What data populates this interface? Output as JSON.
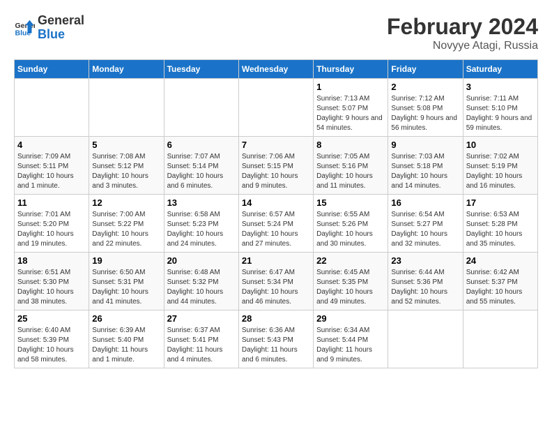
{
  "header": {
    "logo_general": "General",
    "logo_blue": "Blue",
    "month_title": "February 2024",
    "subtitle": "Novyye Atagi, Russia"
  },
  "weekdays": [
    "Sunday",
    "Monday",
    "Tuesday",
    "Wednesday",
    "Thursday",
    "Friday",
    "Saturday"
  ],
  "weeks": [
    [
      {
        "day": "",
        "sunrise": "",
        "sunset": "",
        "daylight": ""
      },
      {
        "day": "",
        "sunrise": "",
        "sunset": "",
        "daylight": ""
      },
      {
        "day": "",
        "sunrise": "",
        "sunset": "",
        "daylight": ""
      },
      {
        "day": "",
        "sunrise": "",
        "sunset": "",
        "daylight": ""
      },
      {
        "day": "1",
        "sunrise": "Sunrise: 7:13 AM",
        "sunset": "Sunset: 5:07 PM",
        "daylight": "Daylight: 9 hours and 54 minutes."
      },
      {
        "day": "2",
        "sunrise": "Sunrise: 7:12 AM",
        "sunset": "Sunset: 5:08 PM",
        "daylight": "Daylight: 9 hours and 56 minutes."
      },
      {
        "day": "3",
        "sunrise": "Sunrise: 7:11 AM",
        "sunset": "Sunset: 5:10 PM",
        "daylight": "Daylight: 9 hours and 59 minutes."
      }
    ],
    [
      {
        "day": "4",
        "sunrise": "Sunrise: 7:09 AM",
        "sunset": "Sunset: 5:11 PM",
        "daylight": "Daylight: 10 hours and 1 minute."
      },
      {
        "day": "5",
        "sunrise": "Sunrise: 7:08 AM",
        "sunset": "Sunset: 5:12 PM",
        "daylight": "Daylight: 10 hours and 3 minutes."
      },
      {
        "day": "6",
        "sunrise": "Sunrise: 7:07 AM",
        "sunset": "Sunset: 5:14 PM",
        "daylight": "Daylight: 10 hours and 6 minutes."
      },
      {
        "day": "7",
        "sunrise": "Sunrise: 7:06 AM",
        "sunset": "Sunset: 5:15 PM",
        "daylight": "Daylight: 10 hours and 9 minutes."
      },
      {
        "day": "8",
        "sunrise": "Sunrise: 7:05 AM",
        "sunset": "Sunset: 5:16 PM",
        "daylight": "Daylight: 10 hours and 11 minutes."
      },
      {
        "day": "9",
        "sunrise": "Sunrise: 7:03 AM",
        "sunset": "Sunset: 5:18 PM",
        "daylight": "Daylight: 10 hours and 14 minutes."
      },
      {
        "day": "10",
        "sunrise": "Sunrise: 7:02 AM",
        "sunset": "Sunset: 5:19 PM",
        "daylight": "Daylight: 10 hours and 16 minutes."
      }
    ],
    [
      {
        "day": "11",
        "sunrise": "Sunrise: 7:01 AM",
        "sunset": "Sunset: 5:20 PM",
        "daylight": "Daylight: 10 hours and 19 minutes."
      },
      {
        "day": "12",
        "sunrise": "Sunrise: 7:00 AM",
        "sunset": "Sunset: 5:22 PM",
        "daylight": "Daylight: 10 hours and 22 minutes."
      },
      {
        "day": "13",
        "sunrise": "Sunrise: 6:58 AM",
        "sunset": "Sunset: 5:23 PM",
        "daylight": "Daylight: 10 hours and 24 minutes."
      },
      {
        "day": "14",
        "sunrise": "Sunrise: 6:57 AM",
        "sunset": "Sunset: 5:24 PM",
        "daylight": "Daylight: 10 hours and 27 minutes."
      },
      {
        "day": "15",
        "sunrise": "Sunrise: 6:55 AM",
        "sunset": "Sunset: 5:26 PM",
        "daylight": "Daylight: 10 hours and 30 minutes."
      },
      {
        "day": "16",
        "sunrise": "Sunrise: 6:54 AM",
        "sunset": "Sunset: 5:27 PM",
        "daylight": "Daylight: 10 hours and 32 minutes."
      },
      {
        "day": "17",
        "sunrise": "Sunrise: 6:53 AM",
        "sunset": "Sunset: 5:28 PM",
        "daylight": "Daylight: 10 hours and 35 minutes."
      }
    ],
    [
      {
        "day": "18",
        "sunrise": "Sunrise: 6:51 AM",
        "sunset": "Sunset: 5:30 PM",
        "daylight": "Daylight: 10 hours and 38 minutes."
      },
      {
        "day": "19",
        "sunrise": "Sunrise: 6:50 AM",
        "sunset": "Sunset: 5:31 PM",
        "daylight": "Daylight: 10 hours and 41 minutes."
      },
      {
        "day": "20",
        "sunrise": "Sunrise: 6:48 AM",
        "sunset": "Sunset: 5:32 PM",
        "daylight": "Daylight: 10 hours and 44 minutes."
      },
      {
        "day": "21",
        "sunrise": "Sunrise: 6:47 AM",
        "sunset": "Sunset: 5:34 PM",
        "daylight": "Daylight: 10 hours and 46 minutes."
      },
      {
        "day": "22",
        "sunrise": "Sunrise: 6:45 AM",
        "sunset": "Sunset: 5:35 PM",
        "daylight": "Daylight: 10 hours and 49 minutes."
      },
      {
        "day": "23",
        "sunrise": "Sunrise: 6:44 AM",
        "sunset": "Sunset: 5:36 PM",
        "daylight": "Daylight: 10 hours and 52 minutes."
      },
      {
        "day": "24",
        "sunrise": "Sunrise: 6:42 AM",
        "sunset": "Sunset: 5:37 PM",
        "daylight": "Daylight: 10 hours and 55 minutes."
      }
    ],
    [
      {
        "day": "25",
        "sunrise": "Sunrise: 6:40 AM",
        "sunset": "Sunset: 5:39 PM",
        "daylight": "Daylight: 10 hours and 58 minutes."
      },
      {
        "day": "26",
        "sunrise": "Sunrise: 6:39 AM",
        "sunset": "Sunset: 5:40 PM",
        "daylight": "Daylight: 11 hours and 1 minute."
      },
      {
        "day": "27",
        "sunrise": "Sunrise: 6:37 AM",
        "sunset": "Sunset: 5:41 PM",
        "daylight": "Daylight: 11 hours and 4 minutes."
      },
      {
        "day": "28",
        "sunrise": "Sunrise: 6:36 AM",
        "sunset": "Sunset: 5:43 PM",
        "daylight": "Daylight: 11 hours and 6 minutes."
      },
      {
        "day": "29",
        "sunrise": "Sunrise: 6:34 AM",
        "sunset": "Sunset: 5:44 PM",
        "daylight": "Daylight: 11 hours and 9 minutes."
      },
      {
        "day": "",
        "sunrise": "",
        "sunset": "",
        "daylight": ""
      },
      {
        "day": "",
        "sunrise": "",
        "sunset": "",
        "daylight": ""
      }
    ]
  ]
}
